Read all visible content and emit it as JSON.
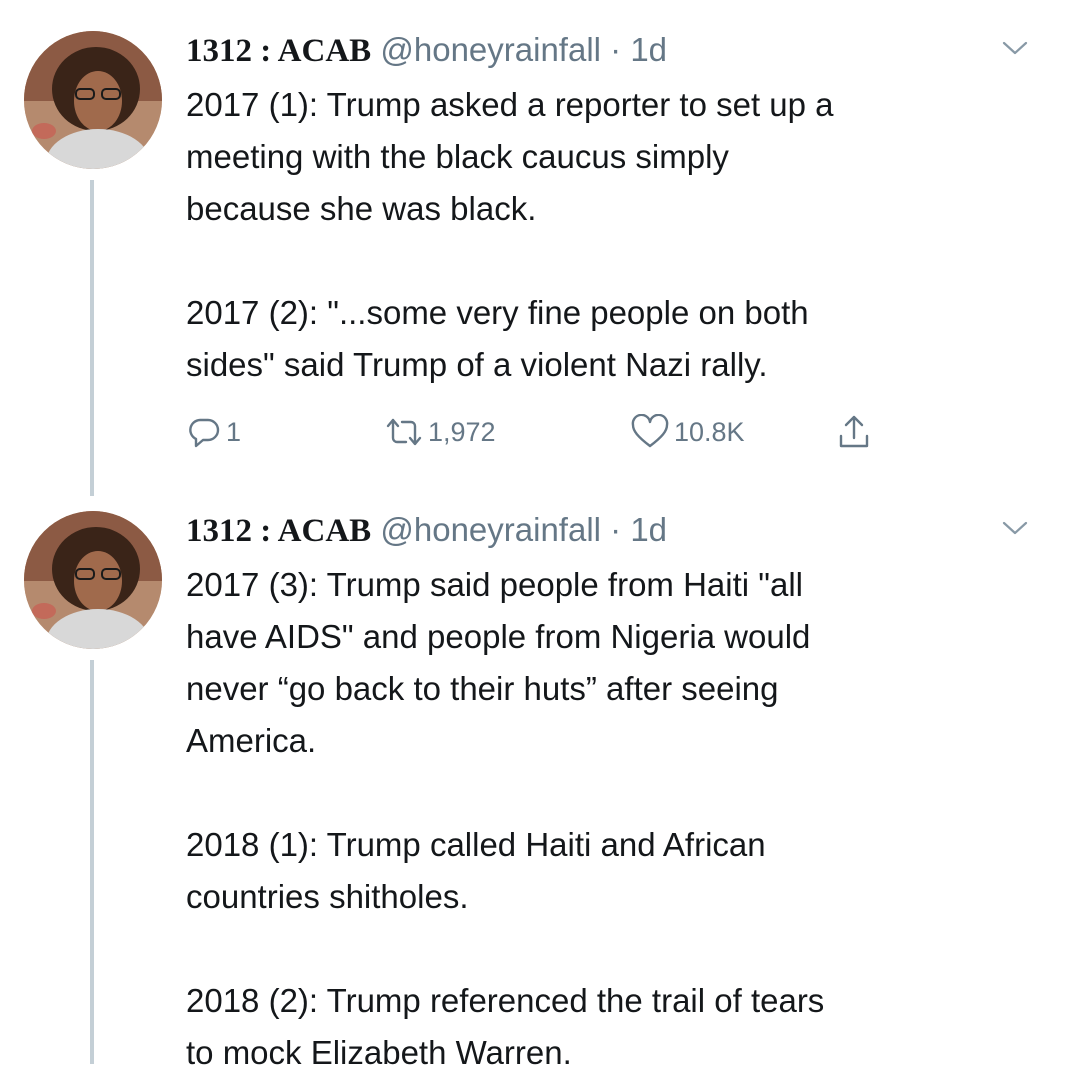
{
  "tweets": [
    {
      "display_name": "1312 : ACAB",
      "handle": "@honeyrainfall",
      "separator": "·",
      "time": "1d",
      "paragraphs": [
        "2017 (1): Trump asked a reporter to set up a\nmeeting with the black caucus simply\nbecause she was black.",
        "2017 (2): \"...some very fine people on both\nsides\" said Trump of a violent Nazi rally."
      ],
      "actions": {
        "replies": "1",
        "retweets": "1,972",
        "likes": "10.8K"
      }
    },
    {
      "display_name": "1312 : ACAB",
      "handle": "@honeyrainfall",
      "separator": "·",
      "time": "1d",
      "paragraphs": [
        "2017 (3): Trump said people from Haiti \"all\nhave AIDS\" and people from Nigeria would\nnever “go back to their huts” after seeing\nAmerica.",
        "2018 (1): Trump called Haiti and African\ncountries shitholes.",
        "2018 (2): Trump referenced the trail of tears\nto mock Elizabeth Warren."
      ]
    }
  ],
  "icons": {
    "reply": "reply-icon",
    "retweet": "retweet-icon",
    "like": "heart-icon",
    "share": "share-icon",
    "menu": "chevron-down-icon"
  },
  "colors": {
    "text": "#14171a",
    "secondary": "#657786",
    "thread_line": "#c4cfd6"
  }
}
